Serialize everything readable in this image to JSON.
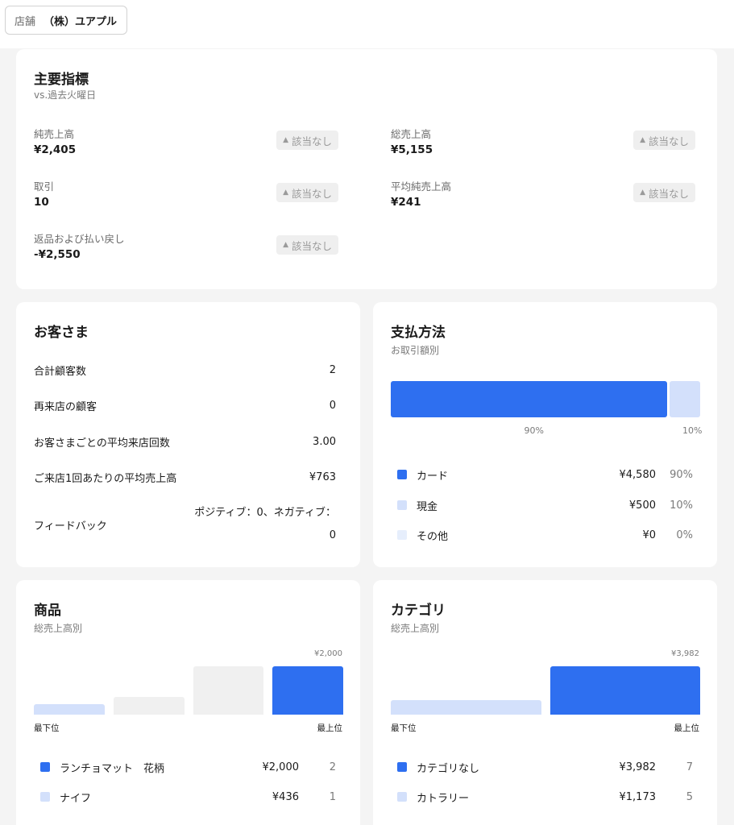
{
  "store": {
    "label": "店舗",
    "name": "（株）ユアプル"
  },
  "colors": {
    "primary": "#2e6ff0",
    "light": "#d3e0fb",
    "lighter": "#e6eefc",
    "gray": "#f0f0f0"
  },
  "key_metrics": {
    "title": "主要指標",
    "subtitle": "vs.過去火曜日",
    "items": [
      {
        "label": "純売上高",
        "value": "¥2,405",
        "badge": "該当なし"
      },
      {
        "label": "総売上高",
        "value": "¥5,155",
        "badge": "該当なし"
      },
      {
        "label": "取引",
        "value": "10",
        "badge": "該当なし"
      },
      {
        "label": "平均純売上高",
        "value": "¥241",
        "badge": "該当なし"
      },
      {
        "label": "返品および払い戻し",
        "value": "-¥2,550",
        "badge": "該当なし"
      }
    ]
  },
  "customers": {
    "title": "お客さま",
    "rows": [
      {
        "label": "合計顧客数",
        "value": "2"
      },
      {
        "label": "再来店の顧客",
        "value": "0"
      },
      {
        "label": "お客さまごとの平均来店回数",
        "value": "3.00"
      },
      {
        "label": "ご来店1回あたりの平均売上高",
        "value": "¥763"
      }
    ],
    "feedback": {
      "label": "フィードバック",
      "line1": "ポジティブ：0、ネガティブ：",
      "line2": "0"
    }
  },
  "payment": {
    "title": "支払方法",
    "subtitle": "お取引額別",
    "bar": [
      {
        "pct_label": "90%",
        "share": 0.9
      },
      {
        "pct_label": "10%",
        "share": 0.1
      }
    ],
    "legend": [
      {
        "name": "カード",
        "amount": "¥4,580",
        "pct": "90%"
      },
      {
        "name": "現金",
        "amount": "¥500",
        "pct": "10%"
      },
      {
        "name": "その他",
        "amount": "¥0",
        "pct": "0%"
      }
    ]
  },
  "products": {
    "title": "商品",
    "subtitle": "総売上高別",
    "top_value": "¥2,000",
    "axis_low": "最下位",
    "axis_high": "最上位",
    "bars": [
      0.218,
      0.37,
      1.0,
      1.0
    ],
    "legend": [
      {
        "name": "ランチョマット　花柄",
        "amount": "¥2,000",
        "count": "2"
      },
      {
        "name": "ナイフ",
        "amount": "¥436",
        "count": "1"
      }
    ]
  },
  "categories": {
    "title": "カテゴリ",
    "subtitle": "総売上高別",
    "top_value": "¥3,982",
    "axis_low": "最下位",
    "axis_high": "最上位",
    "bars": [
      0.295,
      1.0
    ],
    "legend": [
      {
        "name": "カテゴリなし",
        "amount": "¥3,982",
        "count": "7"
      },
      {
        "name": "カトラリー",
        "amount": "¥1,173",
        "count": "5"
      }
    ]
  }
}
